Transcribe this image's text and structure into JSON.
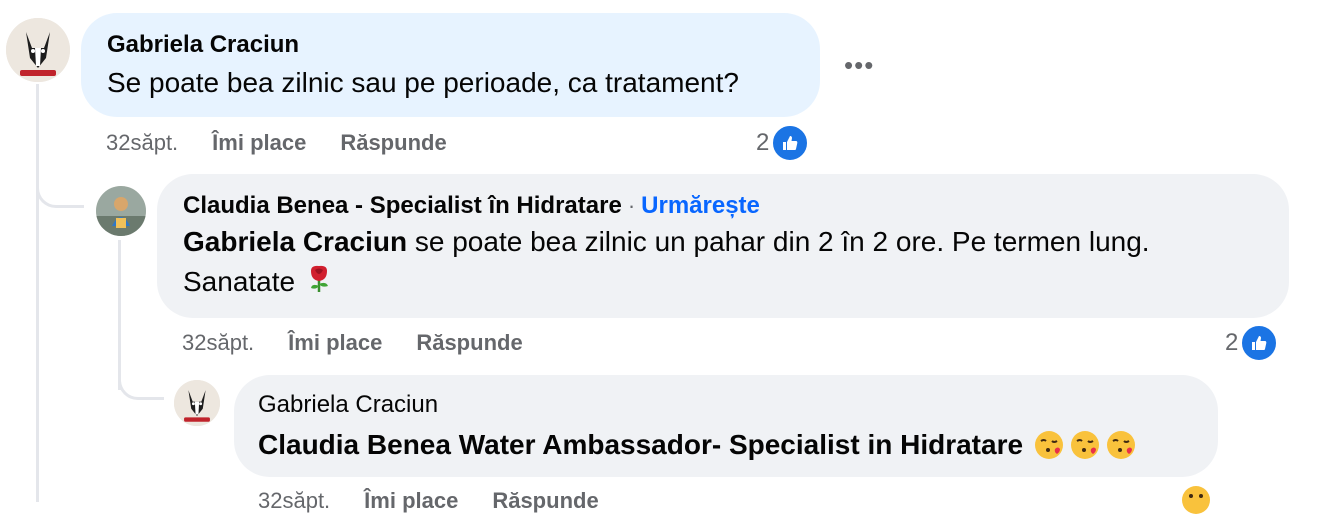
{
  "comments": [
    {
      "author": "Gabriela Craciun",
      "text": "Se poate bea zilnic sau pe perioade, ca tratament?",
      "time": "32săpt.",
      "like_label": "Îmi place",
      "reply_label": "Răspunde",
      "reaction_count": "2"
    },
    {
      "author": "Claudia Benea - Specialist în Hidratare",
      "separator": "·",
      "follow_label": "Urmărește",
      "mention": "Gabriela Craciun",
      "text": " se poate bea zilnic un pahar din 2 în 2 ore. Pe termen lung. Sanatate",
      "emoji": "rose",
      "time": "32săpt.",
      "like_label": "Îmi place",
      "reply_label": "Răspunde",
      "reaction_count": "2"
    },
    {
      "author": "Gabriela Craciun",
      "mention": "Claudia Benea Water Ambassador- Specialist in Hidratare",
      "emojis": [
        "face-blowing-kiss",
        "face-blowing-kiss",
        "face-blowing-kiss"
      ],
      "time": "32săpt.",
      "like_label": "Îmi place",
      "reply_label": "Răspunde"
    }
  ],
  "colors": {
    "bubble_first": "#e7f3ff",
    "bubble": "#f0f2f5",
    "link": "#0866ff",
    "meta": "#65676b",
    "like": "#1b74e4"
  }
}
